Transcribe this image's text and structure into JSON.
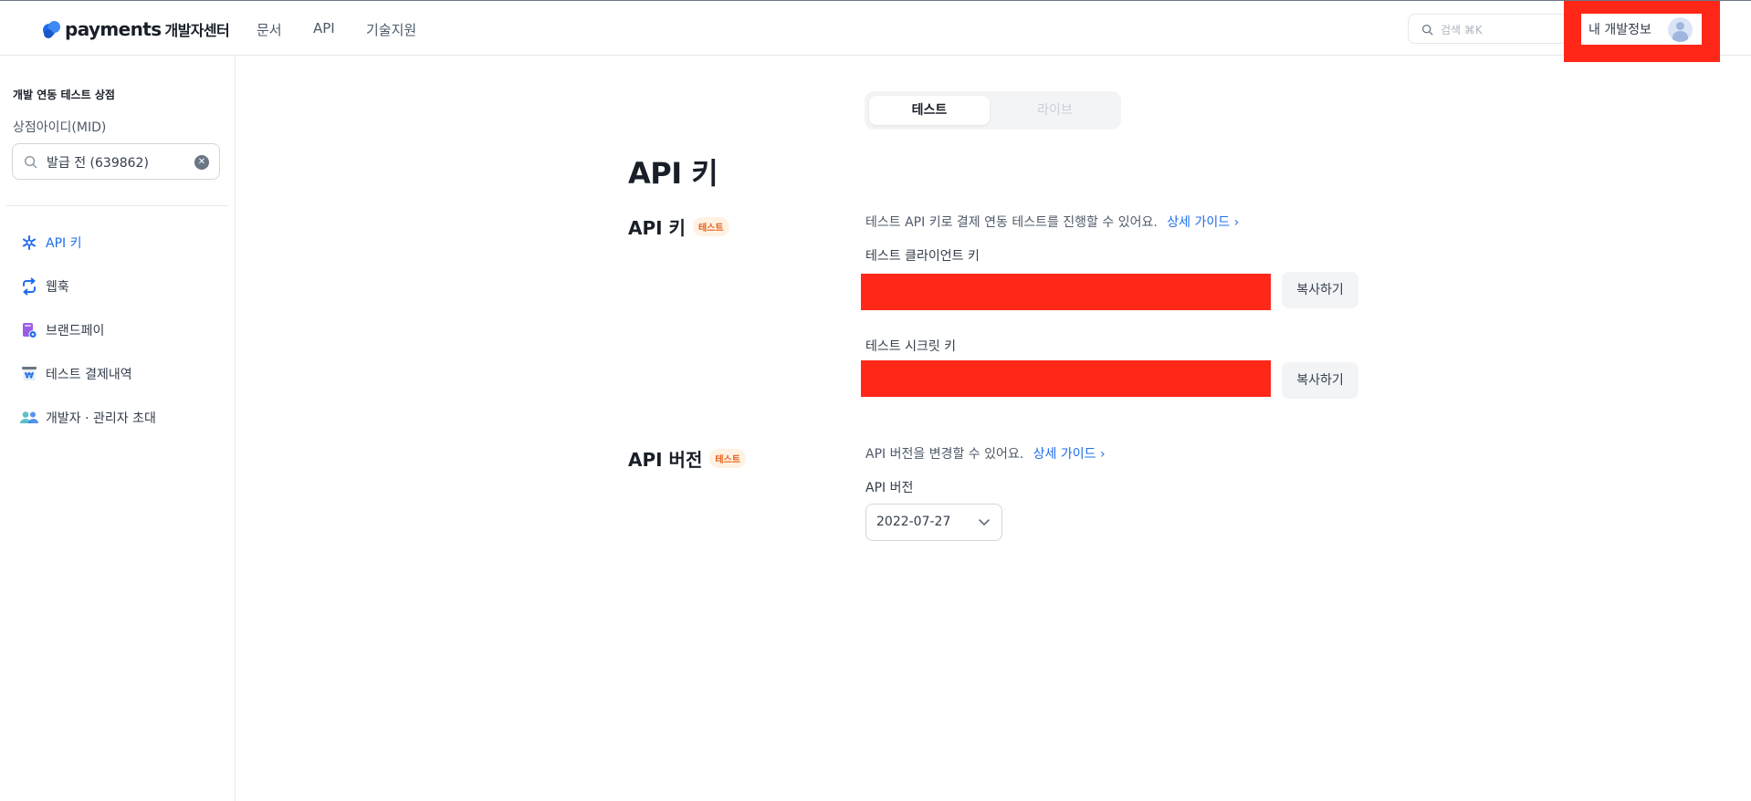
{
  "header": {
    "logo_text": "payments",
    "logo_sub": "개발자센터",
    "nav": [
      "문서",
      "API",
      "기술지원"
    ],
    "search_placeholder": "검색 ⌘K",
    "my_info": "내 개발정보"
  },
  "sidebar": {
    "store_name": "개발 연동 테스트 상점",
    "mid_label": "상점아이디(MID)",
    "mid_value": "발급 전 (639862)",
    "items": [
      {
        "label": "API 키",
        "icon": "api-key-icon",
        "active": true
      },
      {
        "label": "웹훅",
        "icon": "webhook-icon",
        "active": false
      },
      {
        "label": "브랜드페이",
        "icon": "brandpay-icon",
        "active": false
      },
      {
        "label": "테스트 결제내역",
        "icon": "payment-history-icon",
        "active": false
      },
      {
        "label": "개발자 · 관리자 초대",
        "icon": "invite-users-icon",
        "active": false
      }
    ]
  },
  "main": {
    "toggle": {
      "test": "테스트",
      "live": "라이브",
      "selected": "테스트"
    },
    "page_title": "API 키",
    "api_key_section": {
      "title": "API 키",
      "badge": "테스트",
      "description": "테스트 API 키로 결제 연동 테스트를 진행할 수 있어요.",
      "guide_link": "상세 가이드",
      "client_key_label": "테스트 클라이언트 키",
      "secret_key_label": "테스트 시크릿 키",
      "copy_label": "복사하기"
    },
    "api_version_section": {
      "title": "API 버전",
      "badge": "테스트",
      "description": "API 버전을 변경할 수 있어요.",
      "guide_link": "상세 가이드",
      "field_label": "API 버전",
      "selected_version": "2022-07-27"
    }
  },
  "colors": {
    "accent": "#1f6dec",
    "redaction": "#ff2718",
    "badge_bg": "#fff2e3",
    "badge_text": "#e5601a"
  }
}
